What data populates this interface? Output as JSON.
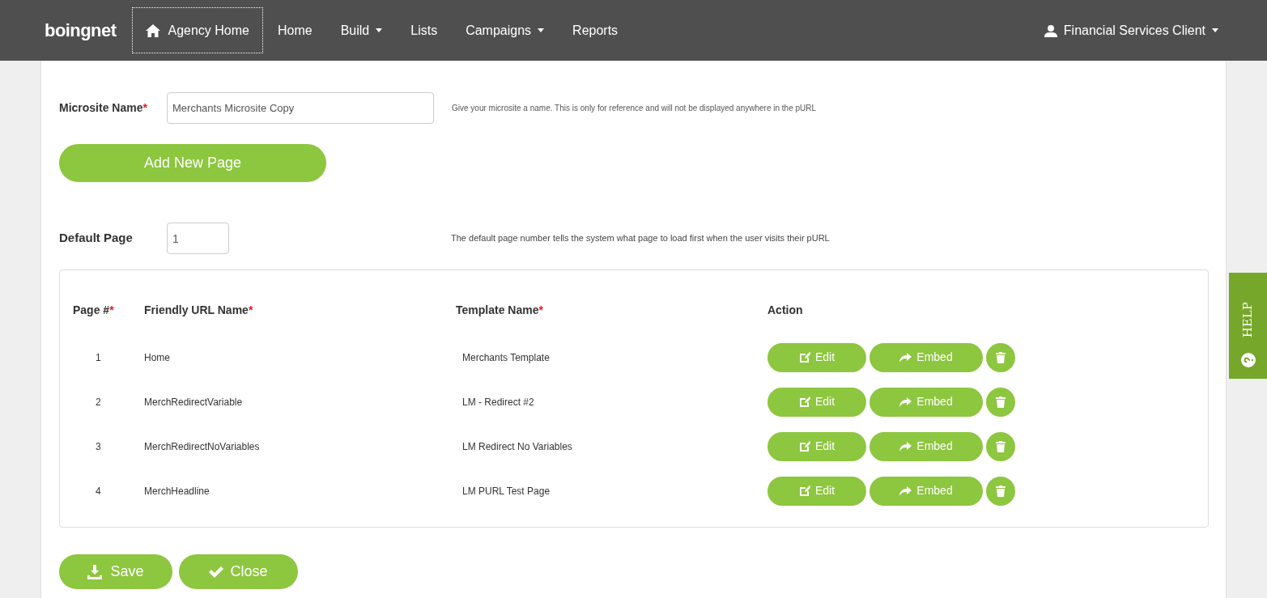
{
  "logo": "boingnet",
  "nav": [
    {
      "label": "Agency Home",
      "selected": true,
      "has_menu": false,
      "kind": "home"
    },
    {
      "label": "Home",
      "selected": false,
      "has_menu": false,
      "kind": "link"
    },
    {
      "label": "Build",
      "selected": false,
      "has_menu": true,
      "kind": "link"
    },
    {
      "label": "Lists",
      "selected": false,
      "has_menu": false,
      "kind": "link"
    },
    {
      "label": "Campaigns",
      "selected": false,
      "has_menu": true,
      "kind": "link"
    },
    {
      "label": "Reports",
      "selected": false,
      "has_menu": false,
      "kind": "link"
    }
  ],
  "user_menu": {
    "label": "Financial Services Client",
    "has_menu": true
  },
  "microsite_name": {
    "label": "Microsite Name",
    "required_mark": "*",
    "value": "Merchants Microsite Copy",
    "hint": "Give your microsite a name. This is only for reference and will not be displayed anywhere in the pURL"
  },
  "add_page_button": "Add New Page",
  "default_page": {
    "label": "Default Page",
    "value": "1",
    "hint": "The default page number tells the system what page to load first when the user visits their pURL"
  },
  "table": {
    "columns": [
      {
        "label": "Page #",
        "required_mark": "*"
      },
      {
        "label": "Friendly URL Name",
        "required_mark": "*"
      },
      {
        "label": "Template Name",
        "required_mark": "*"
      },
      {
        "label": "Action"
      }
    ],
    "rows": [
      {
        "page": "1",
        "friendly_url": "Home",
        "template": "Merchants Template",
        "edit": "Edit",
        "embed": "Embed"
      },
      {
        "page": "2",
        "friendly_url": "MerchRedirectVariable",
        "template": "LM - Redirect #2",
        "edit": "Edit",
        "embed": "Embed"
      },
      {
        "page": "3",
        "friendly_url": "MerchRedirectNoVariables",
        "template": "LM Redirect No Variables",
        "edit": "Edit",
        "embed": "Embed"
      },
      {
        "page": "4",
        "friendly_url": "MerchHeadline",
        "template": "LM PURL Test Page",
        "edit": "Edit",
        "embed": "Embed"
      }
    ]
  },
  "footer_buttons": [
    {
      "label": "Save",
      "kind": "save"
    },
    {
      "label": "Close",
      "kind": "close"
    }
  ],
  "help_tab": "HELP"
}
